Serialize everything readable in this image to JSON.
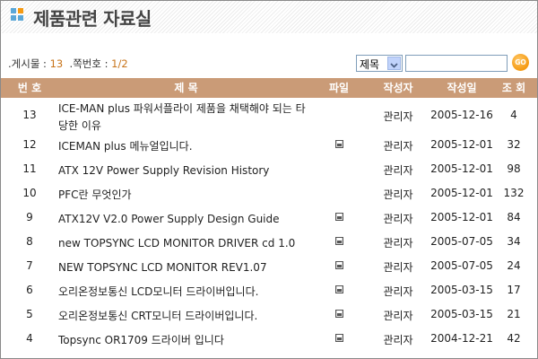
{
  "title": "제품관련 자료실",
  "info": {
    "posts_label": ".게시물 : ",
    "posts": "13",
    "page_label": ".쪽번호 : ",
    "page": "1/2"
  },
  "search": {
    "field": "제목",
    "value": "",
    "go": "GO"
  },
  "columns": {
    "no": "번 호",
    "title": "제 목",
    "file": "파일",
    "author": "작성자",
    "date": "작성일",
    "views": "조 회"
  },
  "colors": {
    "header": "#ca9b77",
    "accent": "#f59a12",
    "count": "#c8741a"
  },
  "rows": [
    {
      "no": "13",
      "title": "ICE-MAN plus 파워서플라이 제품을 채택해야 되는 타당한 이유",
      "file": false,
      "author": "관리자",
      "date": "2005-12-16",
      "views": "4"
    },
    {
      "no": "12",
      "title": "ICEMAN plus 메뉴얼입니다.",
      "file": true,
      "author": "관리자",
      "date": "2005-12-01",
      "views": "32"
    },
    {
      "no": "11",
      "title": "ATX 12V Power Supply Revision History",
      "file": false,
      "author": "관리자",
      "date": "2005-12-01",
      "views": "98"
    },
    {
      "no": "10",
      "title": "PFC란 무엇인가",
      "file": false,
      "author": "관리자",
      "date": "2005-12-01",
      "views": "132"
    },
    {
      "no": "9",
      "title": "ATX12V V2.0 Power Supply Design Guide",
      "file": true,
      "author": "관리자",
      "date": "2005-12-01",
      "views": "84"
    },
    {
      "no": "8",
      "title": "new TOPSYNC LCD MONITOR DRIVER cd 1.0",
      "file": true,
      "author": "관리자",
      "date": "2005-07-05",
      "views": "34"
    },
    {
      "no": "7",
      "title": "NEW TOPSYNC LCD MONITOR REV1.07",
      "file": true,
      "author": "관리자",
      "date": "2005-07-05",
      "views": "24"
    },
    {
      "no": "6",
      "title": "오리온정보통신 LCD모니터 드라이버입니다.",
      "file": true,
      "author": "관리자",
      "date": "2005-03-15",
      "views": "17"
    },
    {
      "no": "5",
      "title": "오리온정보통신 CRT모니터 드라이버입니다.",
      "file": true,
      "author": "관리자",
      "date": "2005-03-15",
      "views": "21"
    },
    {
      "no": "4",
      "title": "Topsync OR1709 드라이버 입니다",
      "file": true,
      "author": "관리자",
      "date": "2004-12-21",
      "views": "42"
    }
  ]
}
